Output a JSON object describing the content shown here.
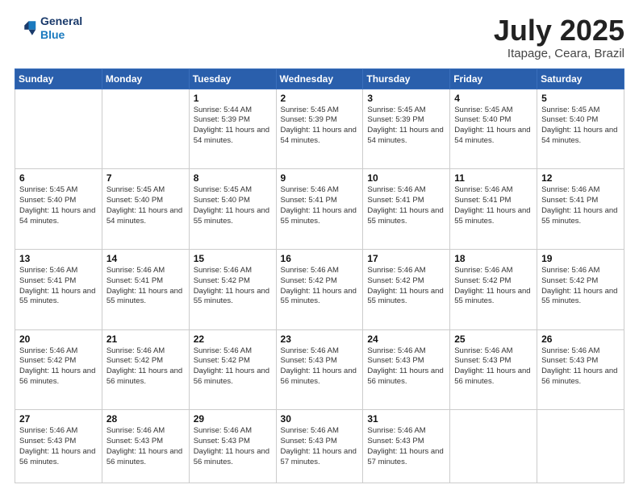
{
  "header": {
    "logo_line1": "General",
    "logo_line2": "Blue",
    "month": "July 2025",
    "location": "Itapage, Ceara, Brazil"
  },
  "weekdays": [
    "Sunday",
    "Monday",
    "Tuesday",
    "Wednesday",
    "Thursday",
    "Friday",
    "Saturday"
  ],
  "weeks": [
    [
      {
        "day": "",
        "info": ""
      },
      {
        "day": "",
        "info": ""
      },
      {
        "day": "1",
        "info": "Sunrise: 5:44 AM\nSunset: 5:39 PM\nDaylight: 11 hours and 54 minutes."
      },
      {
        "day": "2",
        "info": "Sunrise: 5:45 AM\nSunset: 5:39 PM\nDaylight: 11 hours and 54 minutes."
      },
      {
        "day": "3",
        "info": "Sunrise: 5:45 AM\nSunset: 5:39 PM\nDaylight: 11 hours and 54 minutes."
      },
      {
        "day": "4",
        "info": "Sunrise: 5:45 AM\nSunset: 5:40 PM\nDaylight: 11 hours and 54 minutes."
      },
      {
        "day": "5",
        "info": "Sunrise: 5:45 AM\nSunset: 5:40 PM\nDaylight: 11 hours and 54 minutes."
      }
    ],
    [
      {
        "day": "6",
        "info": "Sunrise: 5:45 AM\nSunset: 5:40 PM\nDaylight: 11 hours and 54 minutes."
      },
      {
        "day": "7",
        "info": "Sunrise: 5:45 AM\nSunset: 5:40 PM\nDaylight: 11 hours and 54 minutes."
      },
      {
        "day": "8",
        "info": "Sunrise: 5:45 AM\nSunset: 5:40 PM\nDaylight: 11 hours and 55 minutes."
      },
      {
        "day": "9",
        "info": "Sunrise: 5:46 AM\nSunset: 5:41 PM\nDaylight: 11 hours and 55 minutes."
      },
      {
        "day": "10",
        "info": "Sunrise: 5:46 AM\nSunset: 5:41 PM\nDaylight: 11 hours and 55 minutes."
      },
      {
        "day": "11",
        "info": "Sunrise: 5:46 AM\nSunset: 5:41 PM\nDaylight: 11 hours and 55 minutes."
      },
      {
        "day": "12",
        "info": "Sunrise: 5:46 AM\nSunset: 5:41 PM\nDaylight: 11 hours and 55 minutes."
      }
    ],
    [
      {
        "day": "13",
        "info": "Sunrise: 5:46 AM\nSunset: 5:41 PM\nDaylight: 11 hours and 55 minutes."
      },
      {
        "day": "14",
        "info": "Sunrise: 5:46 AM\nSunset: 5:41 PM\nDaylight: 11 hours and 55 minutes."
      },
      {
        "day": "15",
        "info": "Sunrise: 5:46 AM\nSunset: 5:42 PM\nDaylight: 11 hours and 55 minutes."
      },
      {
        "day": "16",
        "info": "Sunrise: 5:46 AM\nSunset: 5:42 PM\nDaylight: 11 hours and 55 minutes."
      },
      {
        "day": "17",
        "info": "Sunrise: 5:46 AM\nSunset: 5:42 PM\nDaylight: 11 hours and 55 minutes."
      },
      {
        "day": "18",
        "info": "Sunrise: 5:46 AM\nSunset: 5:42 PM\nDaylight: 11 hours and 55 minutes."
      },
      {
        "day": "19",
        "info": "Sunrise: 5:46 AM\nSunset: 5:42 PM\nDaylight: 11 hours and 55 minutes."
      }
    ],
    [
      {
        "day": "20",
        "info": "Sunrise: 5:46 AM\nSunset: 5:42 PM\nDaylight: 11 hours and 56 minutes."
      },
      {
        "day": "21",
        "info": "Sunrise: 5:46 AM\nSunset: 5:42 PM\nDaylight: 11 hours and 56 minutes."
      },
      {
        "day": "22",
        "info": "Sunrise: 5:46 AM\nSunset: 5:42 PM\nDaylight: 11 hours and 56 minutes."
      },
      {
        "day": "23",
        "info": "Sunrise: 5:46 AM\nSunset: 5:43 PM\nDaylight: 11 hours and 56 minutes."
      },
      {
        "day": "24",
        "info": "Sunrise: 5:46 AM\nSunset: 5:43 PM\nDaylight: 11 hours and 56 minutes."
      },
      {
        "day": "25",
        "info": "Sunrise: 5:46 AM\nSunset: 5:43 PM\nDaylight: 11 hours and 56 minutes."
      },
      {
        "day": "26",
        "info": "Sunrise: 5:46 AM\nSunset: 5:43 PM\nDaylight: 11 hours and 56 minutes."
      }
    ],
    [
      {
        "day": "27",
        "info": "Sunrise: 5:46 AM\nSunset: 5:43 PM\nDaylight: 11 hours and 56 minutes."
      },
      {
        "day": "28",
        "info": "Sunrise: 5:46 AM\nSunset: 5:43 PM\nDaylight: 11 hours and 56 minutes."
      },
      {
        "day": "29",
        "info": "Sunrise: 5:46 AM\nSunset: 5:43 PM\nDaylight: 11 hours and 56 minutes."
      },
      {
        "day": "30",
        "info": "Sunrise: 5:46 AM\nSunset: 5:43 PM\nDaylight: 11 hours and 57 minutes."
      },
      {
        "day": "31",
        "info": "Sunrise: 5:46 AM\nSunset: 5:43 PM\nDaylight: 11 hours and 57 minutes."
      },
      {
        "day": "",
        "info": ""
      },
      {
        "day": "",
        "info": ""
      }
    ]
  ]
}
